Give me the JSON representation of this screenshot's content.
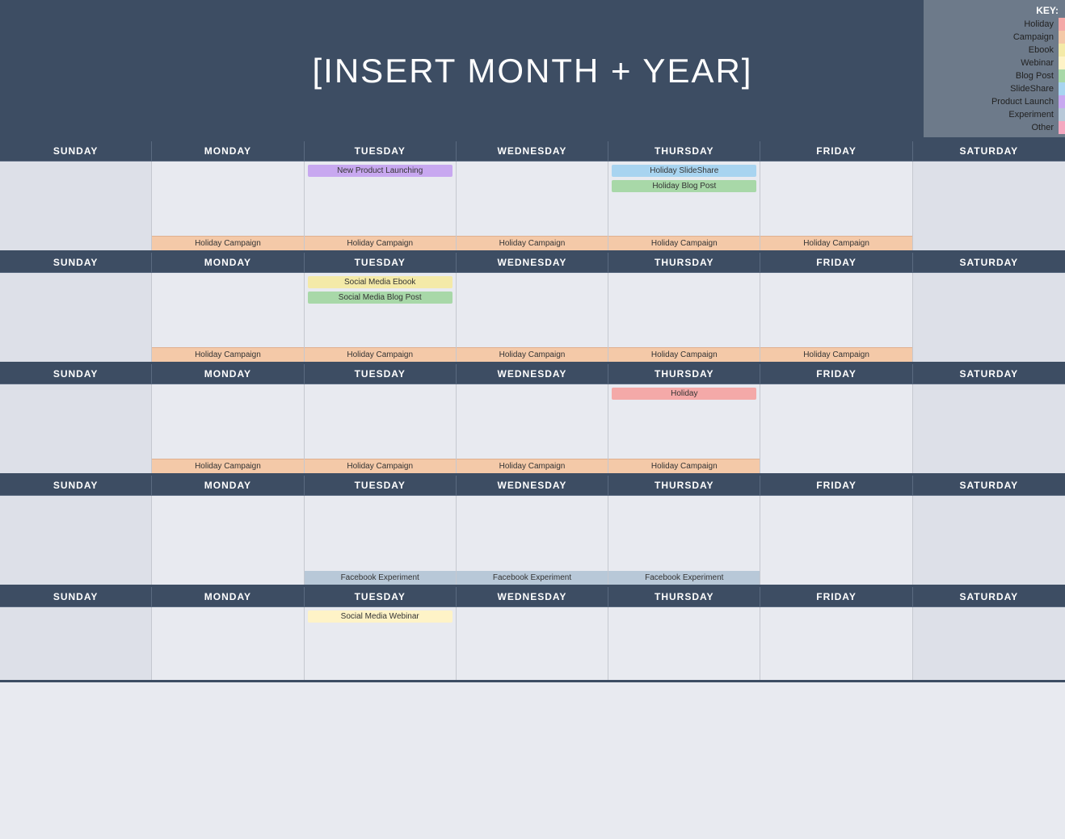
{
  "header": {
    "title": "[INSERT MONTH + YEAR]"
  },
  "key": {
    "title": "KEY:",
    "items": [
      {
        "label": "Holiday",
        "color": "#f4a9a8"
      },
      {
        "label": "Campaign",
        "color": "#f4c9a8"
      },
      {
        "label": "Ebook",
        "color": "#f4eaa8"
      },
      {
        "label": "Webinar",
        "color": "#fef3c7"
      },
      {
        "label": "Blog Post",
        "color": "#a8d8a8"
      },
      {
        "label": "SlideShare",
        "color": "#a8d4f0"
      },
      {
        "label": "Product Launch",
        "color": "#c8a8f0"
      },
      {
        "label": "Experiment",
        "color": "#b8c8d8"
      },
      {
        "label": "Other",
        "color": "#f4a8c0"
      }
    ]
  },
  "days": [
    "SUNDAY",
    "MONDAY",
    "TUESDAY",
    "WEDNESDAY",
    "THURSDAY",
    "FRIDAY",
    "SATURDAY"
  ],
  "weeks": [
    {
      "cells": [
        {
          "events": [],
          "footer": ""
        },
        {
          "events": [],
          "footer": "Holiday Campaign"
        },
        {
          "events": [
            "New Product Launching"
          ],
          "eventTypes": [
            "productlaunch"
          ],
          "footer": "Holiday Campaign"
        },
        {
          "events": [],
          "footer": "Holiday Campaign"
        },
        {
          "events": [
            "Holiday SlideShare",
            "Holiday Blog Post"
          ],
          "eventTypes": [
            "slideshare",
            "blogpost"
          ],
          "footer": "Holiday Campaign"
        },
        {
          "events": [],
          "footer": "Holiday Campaign"
        },
        {
          "events": [],
          "footer": ""
        }
      ]
    },
    {
      "cells": [
        {
          "events": [],
          "footer": ""
        },
        {
          "events": [],
          "footer": "Holiday Campaign"
        },
        {
          "events": [
            "Social Media Ebook",
            "Social Media Blog Post"
          ],
          "eventTypes": [
            "ebook",
            "blogpost"
          ],
          "footer": "Holiday Campaign"
        },
        {
          "events": [],
          "footer": "Holiday Campaign"
        },
        {
          "events": [],
          "footer": "Holiday Campaign"
        },
        {
          "events": [],
          "footer": "Holiday Campaign"
        },
        {
          "events": [],
          "footer": ""
        }
      ]
    },
    {
      "cells": [
        {
          "events": [],
          "footer": ""
        },
        {
          "events": [],
          "footer": "Holiday Campaign"
        },
        {
          "events": [],
          "footer": "Holiday Campaign"
        },
        {
          "events": [],
          "footer": "Holiday Campaign"
        },
        {
          "events": [
            "Holiday"
          ],
          "eventTypes": [
            "holiday"
          ],
          "footer": "Holiday Campaign"
        },
        {
          "events": [],
          "footer": ""
        },
        {
          "events": [],
          "footer": ""
        }
      ]
    },
    {
      "cells": [
        {
          "events": [],
          "footer": ""
        },
        {
          "events": [],
          "footer": ""
        },
        {
          "events": [],
          "footer": "Facebook Experiment"
        },
        {
          "events": [],
          "footer": "Facebook Experiment"
        },
        {
          "events": [],
          "footer": "Facebook Experiment"
        },
        {
          "events": [],
          "footer": ""
        },
        {
          "events": [],
          "footer": ""
        }
      ]
    },
    {
      "cells": [
        {
          "events": [],
          "footer": ""
        },
        {
          "events": [],
          "footer": ""
        },
        {
          "events": [
            "Social Media Webinar"
          ],
          "eventTypes": [
            "webinar"
          ],
          "footer": ""
        },
        {
          "events": [],
          "footer": ""
        },
        {
          "events": [],
          "footer": ""
        },
        {
          "events": [],
          "footer": ""
        },
        {
          "events": [],
          "footer": ""
        }
      ]
    }
  ]
}
